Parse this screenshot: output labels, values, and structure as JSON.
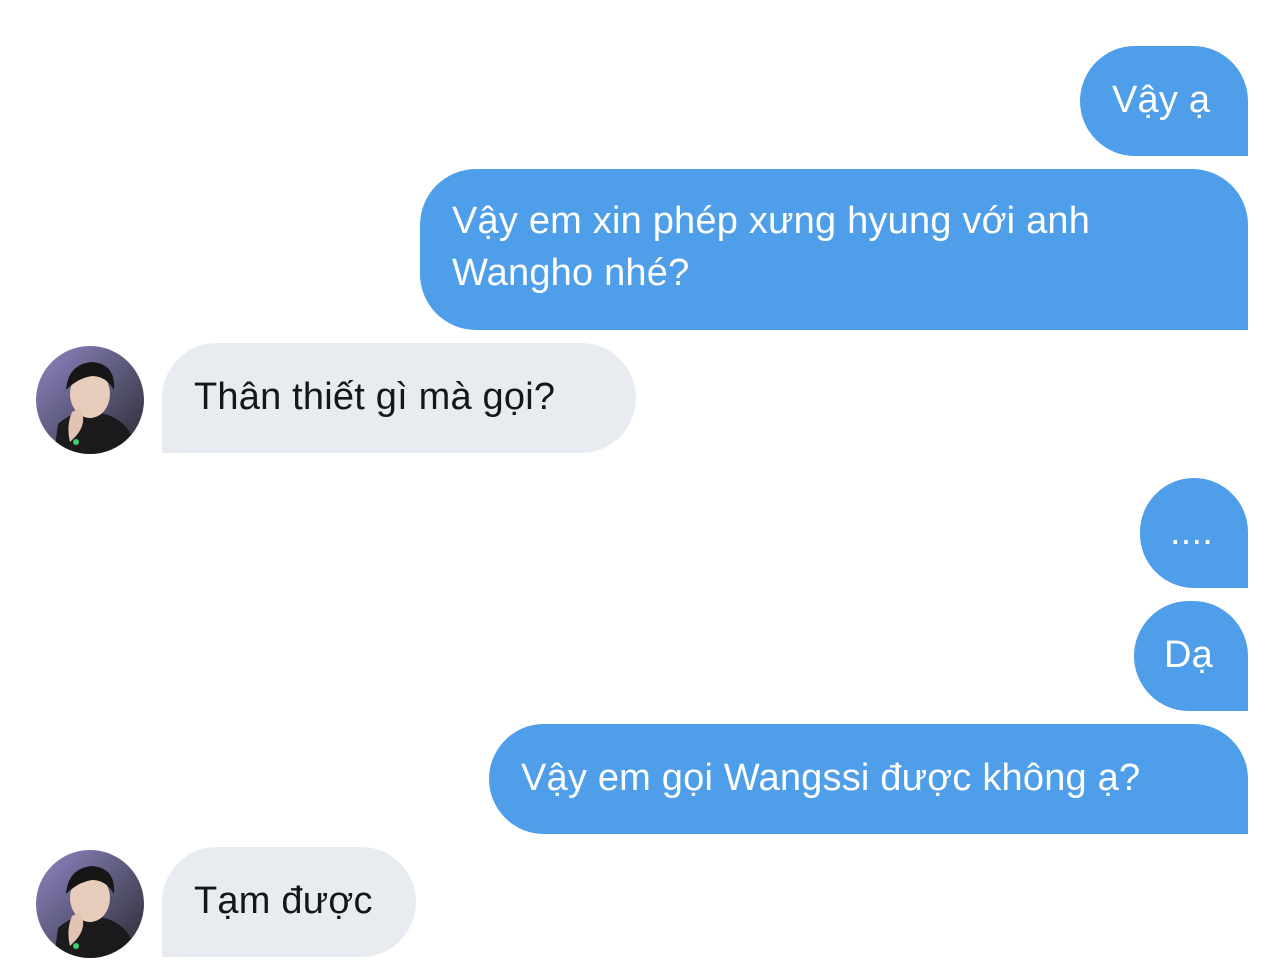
{
  "conversation": {
    "messages": [
      {
        "id": "m1",
        "direction": "sent",
        "text": "Vậy ạ"
      },
      {
        "id": "m2",
        "direction": "sent",
        "text": "Vậy em xin phép xưng hyung với anh Wangho nhé?"
      },
      {
        "id": "m3",
        "direction": "received",
        "text": "Thân thiết gì mà gọi?"
      },
      {
        "id": "m4",
        "direction": "sent",
        "text": "...."
      },
      {
        "id": "m5",
        "direction": "sent",
        "text": "Dạ"
      },
      {
        "id": "m6",
        "direction": "sent",
        "text": "Vậy em gọi Wangssi được không ạ?"
      },
      {
        "id": "m7",
        "direction": "received",
        "text": "Tạm được"
      }
    ]
  },
  "colors": {
    "sent_bubble": "#4e9ee9",
    "received_bubble": "#e8ecf0",
    "sent_text": "#ffffff",
    "received_text": "#14171a",
    "background": "#ffffff"
  },
  "icons": {
    "avatar": "contact-avatar-photo"
  }
}
